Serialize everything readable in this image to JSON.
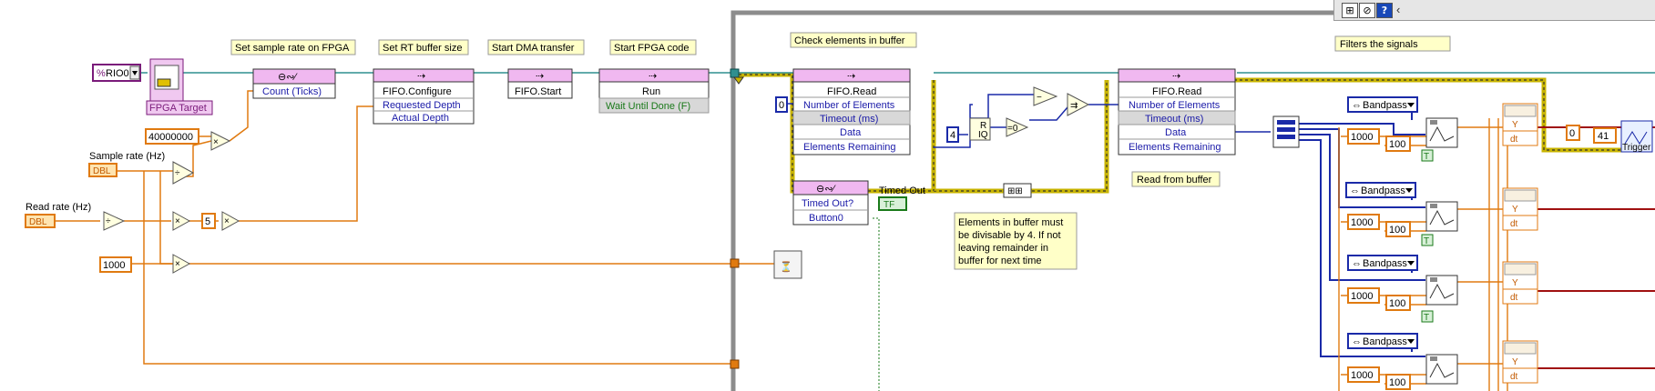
{
  "labels": {
    "set_sample_rate": "Set sample rate on FPGA",
    "set_buffer": "Set RT buffer size",
    "start_dma": "Start DMA transfer",
    "start_fpga": "Start FPGA code",
    "check_elements": "Check elements in buffer",
    "filters": "Filters the signals",
    "read_from_buffer": "Read from buffer",
    "note_lines": [
      "Elements in buffer must",
      "be divisable by 4. If not",
      "leaving remainder in",
      "buffer for next time"
    ]
  },
  "resource": {
    "name": "RIO0",
    "target_label": "FPGA Target"
  },
  "controls": {
    "sample_rate_label": "Sample rate (Hz)",
    "read_rate_label": "Read rate (Hz)",
    "dbl": "DBL",
    "timed_out_label": "Timed Out",
    "tf": "TF"
  },
  "constants": {
    "c40m": "40000000",
    "c5": "5",
    "c1000": "1000",
    "c0a": "0",
    "c4": "4",
    "c1000f": "1000",
    "c100": "100",
    "c0b": "0",
    "c41": "41"
  },
  "nodes": {
    "prop": {
      "title": "",
      "row": "Count (Ticks)"
    },
    "cfg": {
      "title": "FIFO.Configure",
      "rows": [
        "Requested Depth",
        "Actual Depth"
      ]
    },
    "start": {
      "title": "FIFO.Start"
    },
    "run": {
      "title": "Run",
      "row": "Wait Until Done (F)"
    },
    "read1": {
      "title": "FIFO.Read",
      "rows": [
        "Number of Elements",
        "Timeout (ms)",
        "Data",
        "Elements Remaining"
      ]
    },
    "read2": {
      "title": "FIFO.Read",
      "rows": [
        "Number of Elements",
        "Timeout (ms)",
        "Data",
        "Elements Remaining"
      ]
    },
    "prop2": {
      "rows": [
        "Timed Out?",
        "Button0"
      ]
    }
  },
  "filters": {
    "type": "Bandpass",
    "count": 4
  },
  "graph": {
    "y": "Y",
    "dt": "dt",
    "trigger": "Trigger"
  },
  "quotient": {
    "r": "R",
    "iq": "IQ"
  },
  "toolbar": {
    "arrow": "‹"
  }
}
